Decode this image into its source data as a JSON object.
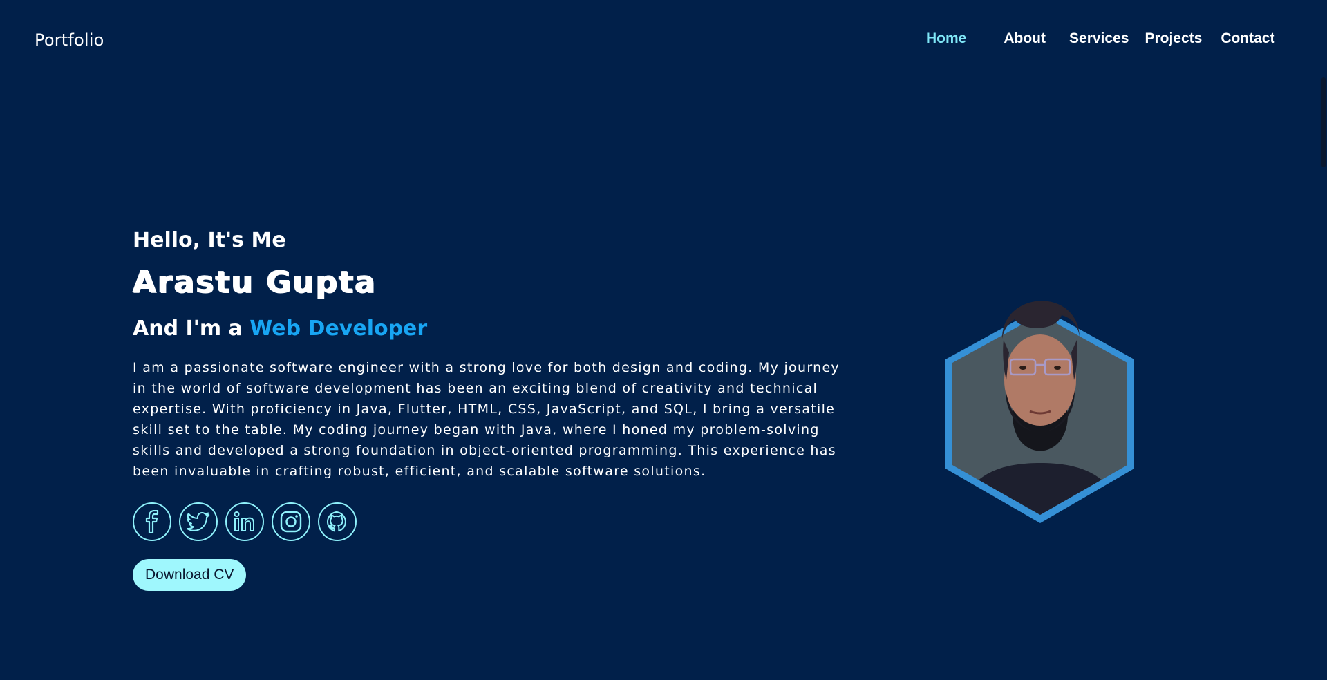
{
  "brand": {
    "name": "Portfolio"
  },
  "nav": {
    "items": [
      {
        "label": "Home",
        "active": true
      },
      {
        "label": "About",
        "active": false
      },
      {
        "label": "Services",
        "active": false
      },
      {
        "label": "Projects",
        "active": false
      },
      {
        "label": "Contact",
        "active": false
      }
    ]
  },
  "hero": {
    "greeting": "Hello, It's Me",
    "name": "Arastu Gupta",
    "role_prefix": "And I'm a",
    "role_highlight": "Web Developer",
    "bio": "I am a passionate software engineer with a strong love for both design and coding. My journey in the world of software development has been an exciting blend of creativity and technical expertise. With proficiency in Java, Flutter, HTML, CSS, JavaScript, and SQL, I bring a versatile skill set to the table. My coding journey began with Java, where I honed my problem-solving skills and developed a strong foundation in object-oriented programming. This experience has been invaluable in crafting robust, efficient, and scalable software solutions.",
    "socials": [
      {
        "name": "facebook",
        "icon": "facebook-icon"
      },
      {
        "name": "twitter",
        "icon": "twitter-icon"
      },
      {
        "name": "linkedin",
        "icon": "linkedin-icon"
      },
      {
        "name": "instagram",
        "icon": "instagram-icon"
      },
      {
        "name": "github",
        "icon": "github-icon"
      }
    ],
    "download_label": "Download CV"
  },
  "colors": {
    "background": "#01204a",
    "accent": "#18a5f3",
    "nav_active": "#7fe6f6",
    "icon_outline": "#8ff1fb",
    "button_bg": "#9ff7fd",
    "hex_border": "#3590d6"
  }
}
